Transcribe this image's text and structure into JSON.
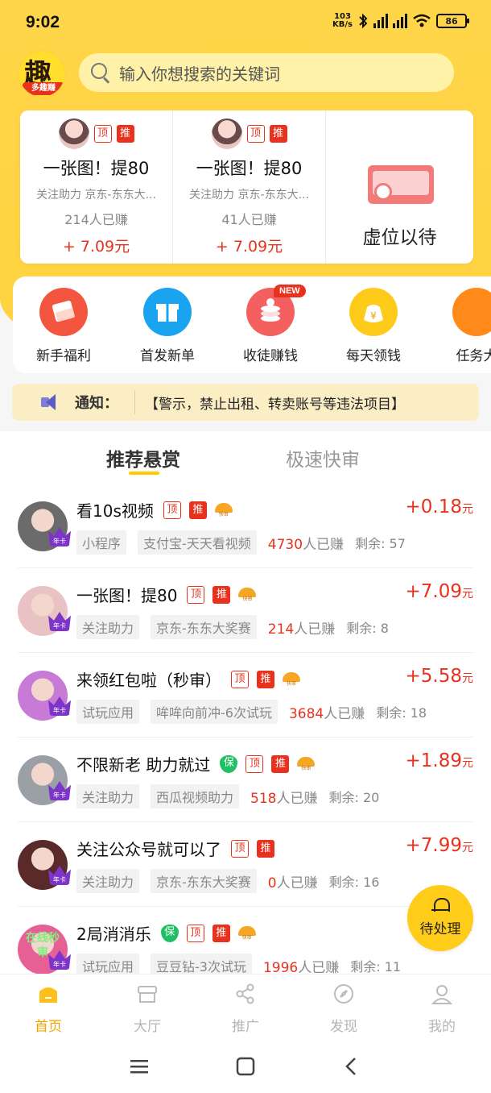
{
  "status_bar": {
    "time": "9:02",
    "net_speed_value": "103",
    "net_speed_unit": "KB/s",
    "battery": "86"
  },
  "logo": {
    "char": "趣",
    "sub": "多趣赚"
  },
  "search": {
    "placeholder": "输入你想搜索的关键词"
  },
  "featured": [
    {
      "title": "一张图！提80",
      "sub": "关注助力 京东-东东大...",
      "count": "214人已赚",
      "price": "+ 7.09元",
      "tag_ding": "顶",
      "tag_tui": "推"
    },
    {
      "title": "一张图！提80",
      "sub": "关注助力 京东-东东大...",
      "count": "41人已赚",
      "price": "+ 7.09元",
      "tag_ding": "顶",
      "tag_tui": "推"
    }
  ],
  "featured_placeholder": {
    "label": "虚位以待"
  },
  "shortcuts": [
    {
      "label": "新手福利",
      "icon": "red-envelope-icon",
      "color": "#f4553f"
    },
    {
      "label": "首发新单",
      "icon": "gift-icon",
      "color": "#1aa3ef"
    },
    {
      "label": "收徒赚钱",
      "icon": "coins-icon",
      "color": "#f46060",
      "badge": "NEW"
    },
    {
      "label": "每天领钱",
      "icon": "money-bag-icon",
      "color": "#ffcb1a"
    },
    {
      "label": "任务大",
      "icon": "task-icon",
      "color": "#ff8a1a"
    }
  ],
  "notice": {
    "label": "通知：",
    "text": "【警示，禁止出租、转卖账号等违法项目】"
  },
  "tabs": [
    {
      "label": "推荐悬赏",
      "active": true
    },
    {
      "label": "极速快审",
      "active": false
    }
  ],
  "tasks": [
    {
      "title": "看10s视频",
      "bao": false,
      "hot": true,
      "cat": "小程序",
      "sub": "支付宝-天天看视频",
      "count": "4730",
      "count_suffix": "人已赚",
      "left": "剩余: 57",
      "price": "+0.18",
      "unit": "元",
      "avatar_color": "#6b6b6b",
      "crown": "年卡"
    },
    {
      "title": "一张图！提80",
      "bao": false,
      "hot": true,
      "cat": "关注助力",
      "sub": "京东-东东大奖赛",
      "count": "214",
      "count_suffix": "人已赚",
      "left": "剩余: 8",
      "price": "+7.09",
      "unit": "元",
      "avatar_color": "#e9c3c3",
      "crown": "年卡"
    },
    {
      "title": "来领红包啦（秒审）",
      "bao": false,
      "hot": true,
      "cat": "试玩应用",
      "sub": "哞哞向前冲-6次试玩",
      "count": "3684",
      "count_suffix": "人已赚",
      "left": "剩余: 18",
      "price": "+5.58",
      "unit": "元",
      "avatar_color": "#c77ad6",
      "crown": "年卡"
    },
    {
      "title": "不限新老 助力就过",
      "bao": true,
      "hot": true,
      "cat": "关注助力",
      "sub": "西瓜视频助力",
      "count": "518",
      "count_suffix": "人已赚",
      "left": "剩余: 20",
      "price": "+1.89",
      "unit": "元",
      "avatar_color": "#9aa0a6",
      "crown": "年卡"
    },
    {
      "title": "关注公众号就可以了",
      "bao": false,
      "hot": false,
      "cat": "关注助力",
      "sub": "京东-东东大奖赛",
      "count": "0",
      "count_suffix": "人已赚",
      "left": "剩余: 16",
      "price": "+7.99",
      "unit": "元",
      "avatar_color": "#5a2a2a",
      "crown": "年卡"
    },
    {
      "title": "2局消消乐",
      "bao": true,
      "hot": true,
      "cat": "试玩应用",
      "sub": "豆豆钻-3次试玩",
      "count": "1996",
      "count_suffix": "人已赚",
      "left": "剩余: 11",
      "price": "+",
      "unit": "",
      "avatar_color": "#e65f95",
      "crown": "年卡",
      "avatar_text": "在线秒审"
    }
  ],
  "task_tags": {
    "ding": "顶",
    "tui": "推",
    "bao": "保"
  },
  "fab": {
    "label": "待处理"
  },
  "bottom_nav": [
    {
      "label": "首页",
      "icon": "home-icon",
      "active": true
    },
    {
      "label": "大厅",
      "icon": "store-icon",
      "active": false
    },
    {
      "label": "推广",
      "icon": "share-icon",
      "active": false
    },
    {
      "label": "发现",
      "icon": "compass-icon",
      "active": false
    },
    {
      "label": "我的",
      "icon": "user-icon",
      "active": false
    }
  ],
  "colors": {
    "brand_yellow": "#ffd23e",
    "accent_red": "#e8321d",
    "nav_active": "#f5a300"
  }
}
